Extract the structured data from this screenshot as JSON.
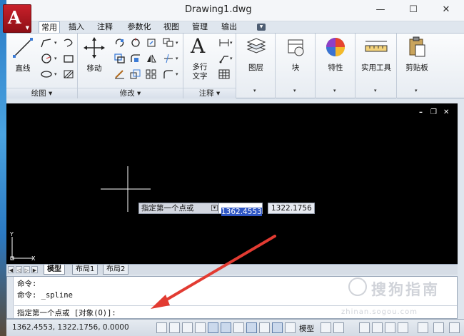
{
  "window": {
    "title": "Drawing1.dwg",
    "controls": {
      "minimize": "—",
      "maximize": "☐",
      "close": "✕"
    }
  },
  "ribbon_tabs": [
    {
      "label": "常用",
      "active": true
    },
    {
      "label": "插入"
    },
    {
      "label": "注释"
    },
    {
      "label": "参数化"
    },
    {
      "label": "视图"
    },
    {
      "label": "管理"
    },
    {
      "label": "输出"
    }
  ],
  "ribbon": {
    "panels": {
      "draw": {
        "title": "绘图",
        "big_tool": "直线"
      },
      "modify": {
        "title": "修改",
        "big_tool": "移动"
      },
      "annotate": {
        "title": "注释",
        "big_tool_line1": "多行",
        "big_tool_line2": "文字"
      },
      "layers": {
        "label": "图层"
      },
      "block": {
        "label": "块"
      },
      "properties": {
        "label": "特性"
      },
      "utilities": {
        "label": "实用工具"
      },
      "clipboard": {
        "label": "剪贴板"
      }
    }
  },
  "viewport": {
    "controls": {
      "minimize": "–",
      "restore": "❐",
      "close": "✕"
    },
    "ucs": {
      "y": "Y",
      "x": "X"
    },
    "dynamic_input": {
      "prompt": "指定第一个点或",
      "x_value": "1362.4553",
      "y_value": "1322.1756"
    }
  },
  "layout_tabs": [
    {
      "label": "模型",
      "active": true
    },
    {
      "label": "布局1"
    },
    {
      "label": "布局2"
    }
  ],
  "command_window": {
    "history": [
      "命令:",
      "命令: _spline"
    ],
    "current_prompt": "指定第一个点或 [对象(O)]:"
  },
  "watermark": {
    "text": "搜狗指南",
    "url": "zhinan.sogou.com"
  },
  "statusbar": {
    "coordinates": "1362.4553,  1322.1756, 0.0000",
    "space_label": "模型"
  },
  "colors": {
    "accent_red": "#e23b32",
    "drawing_bg": "#000000",
    "selection_blue": "#2f56c4"
  }
}
